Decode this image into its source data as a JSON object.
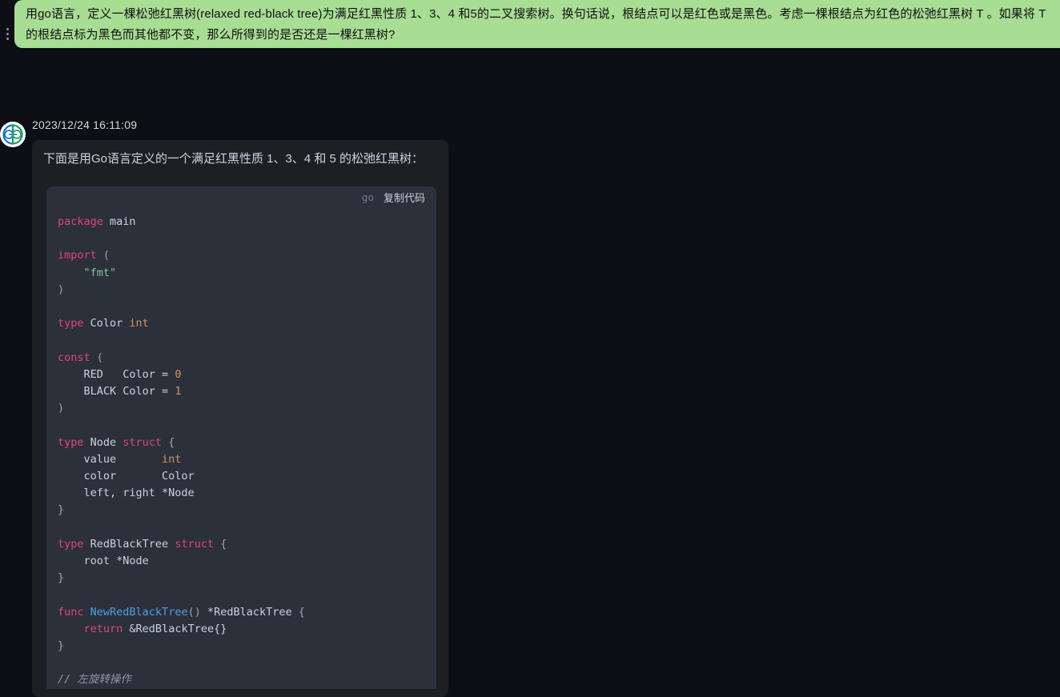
{
  "user_message": {
    "kebab_icon": "vertical-dots-icon",
    "text": "用go语言，定义一棵松弛红黑树(relaxed red-black tree)为满足红黑性质 1、3、4 和5的二叉搜索树。换句话说，根结点可以是红色或是黑色。考虑一棵根结点为红色的松弛红黑树 T 。如果将 T 的根结点标为黑色而其他都不变，那么所得到的是否还是一棵红黑树?",
    "bubble_color": "#a8dd94"
  },
  "assistant_message": {
    "avatar_alt": "assistant-avatar",
    "timestamp": "2023/12/24 16:11:09",
    "intro_text": "下面是用Go语言定义的一个满足红黑性质 1、3、4 和 5 的松弛红黑树：",
    "code_block": {
      "language_label": "go",
      "copy_label": "复制代码",
      "lines": [
        [
          {
            "t": "kw",
            "s": "package"
          },
          {
            "t": "pl",
            "s": " main"
          }
        ],
        [],
        [
          {
            "t": "kw",
            "s": "import"
          },
          {
            "t": "punc",
            "s": " ("
          }
        ],
        [
          {
            "t": "str",
            "s": "    \"fmt\""
          }
        ],
        [
          {
            "t": "punc",
            "s": ")"
          }
        ],
        [],
        [
          {
            "t": "kw",
            "s": "type"
          },
          {
            "t": "pl",
            "s": " Color "
          },
          {
            "t": "type",
            "s": "int"
          }
        ],
        [],
        [
          {
            "t": "kw",
            "s": "const"
          },
          {
            "t": "punc",
            "s": " ("
          }
        ],
        [
          {
            "t": "pl",
            "s": "    RED   Color = "
          },
          {
            "t": "num",
            "s": "0"
          }
        ],
        [
          {
            "t": "pl",
            "s": "    BLACK Color = "
          },
          {
            "t": "num",
            "s": "1"
          }
        ],
        [
          {
            "t": "punc",
            "s": ")"
          }
        ],
        [],
        [
          {
            "t": "kw",
            "s": "type"
          },
          {
            "t": "pl",
            "s": " Node "
          },
          {
            "t": "kw",
            "s": "struct"
          },
          {
            "t": "punc",
            "s": " {"
          }
        ],
        [
          {
            "t": "pl",
            "s": "    value       "
          },
          {
            "t": "type",
            "s": "int"
          }
        ],
        [
          {
            "t": "pl",
            "s": "    color       Color"
          }
        ],
        [
          {
            "t": "pl",
            "s": "    left, right *Node"
          }
        ],
        [
          {
            "t": "punc",
            "s": "}"
          }
        ],
        [],
        [
          {
            "t": "kw",
            "s": "type"
          },
          {
            "t": "pl",
            "s": " RedBlackTree "
          },
          {
            "t": "kw",
            "s": "struct"
          },
          {
            "t": "punc",
            "s": " {"
          }
        ],
        [
          {
            "t": "pl",
            "s": "    root *Node"
          }
        ],
        [
          {
            "t": "punc",
            "s": "}"
          }
        ],
        [],
        [
          {
            "t": "kw",
            "s": "func"
          },
          {
            "t": "pl",
            "s": " "
          },
          {
            "t": "fn",
            "s": "NewRedBlackTree"
          },
          {
            "t": "punc",
            "s": "()"
          },
          {
            "t": "pl",
            "s": " *RedBlackTree "
          },
          {
            "t": "punc",
            "s": "{"
          }
        ],
        [
          {
            "t": "pl",
            "s": "    "
          },
          {
            "t": "kw",
            "s": "return"
          },
          {
            "t": "pl",
            "s": " &RedBlackTree{}"
          }
        ],
        [
          {
            "t": "punc",
            "s": "}"
          }
        ],
        [],
        [
          {
            "t": "cmt",
            "s": "// 左旋转操作"
          }
        ]
      ]
    }
  },
  "colors": {
    "page_background": "#0d0f14",
    "bubble_background": "#1d1f23",
    "code_background": "#2b303b",
    "user_bubble": "#a8dd94",
    "keyword": "#e0457b",
    "function": "#4d9ee6",
    "string": "#7ec699",
    "number": "#d4915d",
    "comment": "#9a8fae"
  }
}
